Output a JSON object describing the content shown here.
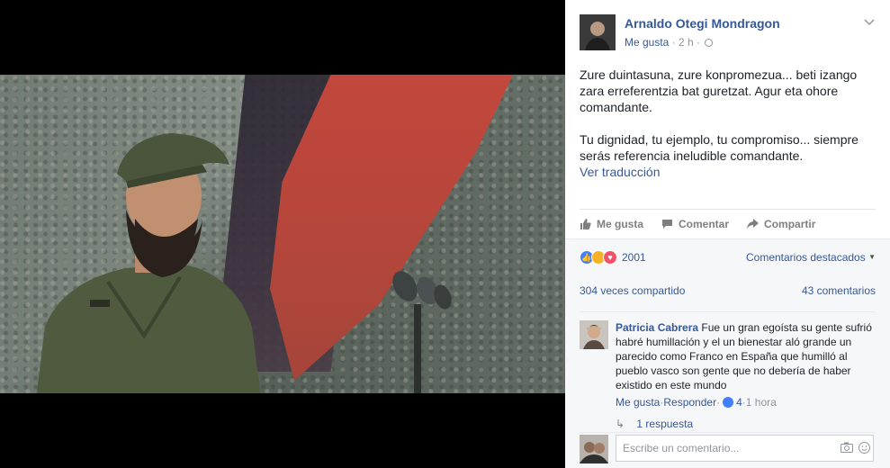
{
  "post": {
    "author": "Arnaldo Otegi Mondragon",
    "meta_like": "Me gusta",
    "meta_sep": " · ",
    "meta_time": "2 h",
    "meta_sep2": " · ",
    "text_eu": "Zure duintasuna, zure konpromezua... beti izango zara erreferentzia bat guretzat. Agur eta ohore comandante.",
    "text_es": "Tu dignidad, tu ejemplo, tu compromiso... siempre serás referencia ineludible comandante.",
    "translate_link": "Ver traducción"
  },
  "actions": {
    "like": "Me gusta",
    "comment": "Comentar",
    "share": "Compartir"
  },
  "reactions": {
    "count": "2001",
    "sort_label": "Comentarios destacados"
  },
  "counts": {
    "shares": "304 veces compartido",
    "comments": "43 comentarios"
  },
  "comment": {
    "name": "Patricia Cabrera",
    "text": "Fue un gran egoísta su gente sufrió habré humillación y el un bienestar aló grande un parecido como Franco en España que humilló al pueblo vasco son gente que no debería de haber existido en este mundo",
    "like": "Me gusta",
    "sep1": " · ",
    "reply": "Responder",
    "sep2": " · ",
    "likes": "4",
    "sep3": " · ",
    "time": "1 hora",
    "replies": "1 respuesta"
  },
  "composer": {
    "placeholder": "Escribe un comentario..."
  },
  "colors": {
    "link": "#365899",
    "muted": "#90949c",
    "like_blue": "#4080ff",
    "love_red": "#f25268"
  }
}
